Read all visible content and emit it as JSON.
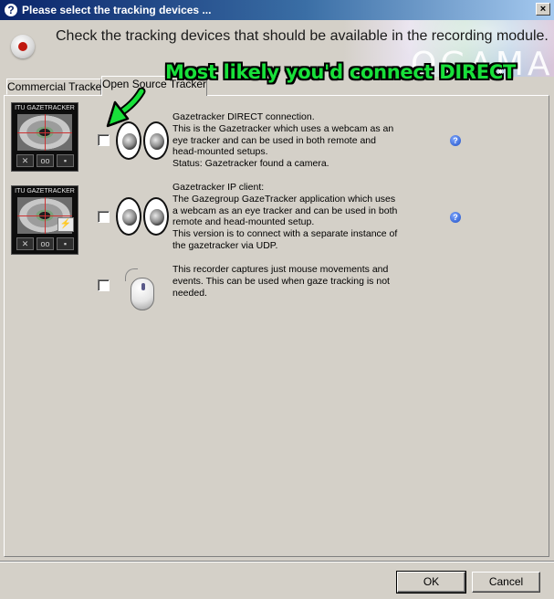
{
  "window": {
    "title_icon": "?",
    "title": "Please select the tracking devices ...",
    "close_glyph": "×"
  },
  "header": {
    "instruction": "Check the tracking devices that should be available in the recording module.",
    "brand": "OGAMA"
  },
  "tabs": [
    {
      "label": "Commercial Tracker",
      "selected": false
    },
    {
      "label": "Open Source Tracker",
      "selected": true
    }
  ],
  "annotation": {
    "text": "Most likely you'd connect DIRECT",
    "color": "#18e03a"
  },
  "thumbnail": {
    "title": "ITU GAZETRACKER"
  },
  "devices": [
    {
      "name": "Gazetracker DIRECT connection.",
      "description": "This is the Gazetracker which uses a webcam as an\neye tracker and can be used in both remote and\nhead-mounted setups.\nStatus: Gazetracker found a camera.",
      "checked": false,
      "icon": "eyes-icon",
      "help_icon": "?"
    },
    {
      "name": "Gazetracker IP client:",
      "description": "The Gazegroup GazeTracker application which uses\na webcam as an eye tracker and can be used in both\nremote and head-mounted setup.\nThis version is to connect with a separate instance of\nthe gazetracker via UDP.",
      "checked": false,
      "icon": "eyes-icon",
      "help_icon": "?"
    },
    {
      "name": "",
      "description": "This recorder captures just mouse movements and\nevents. This can be used when gaze tracking is not\nneeded.",
      "checked": false,
      "icon": "mouse-icon"
    }
  ],
  "buttons": {
    "ok": "OK",
    "cancel": "Cancel"
  }
}
